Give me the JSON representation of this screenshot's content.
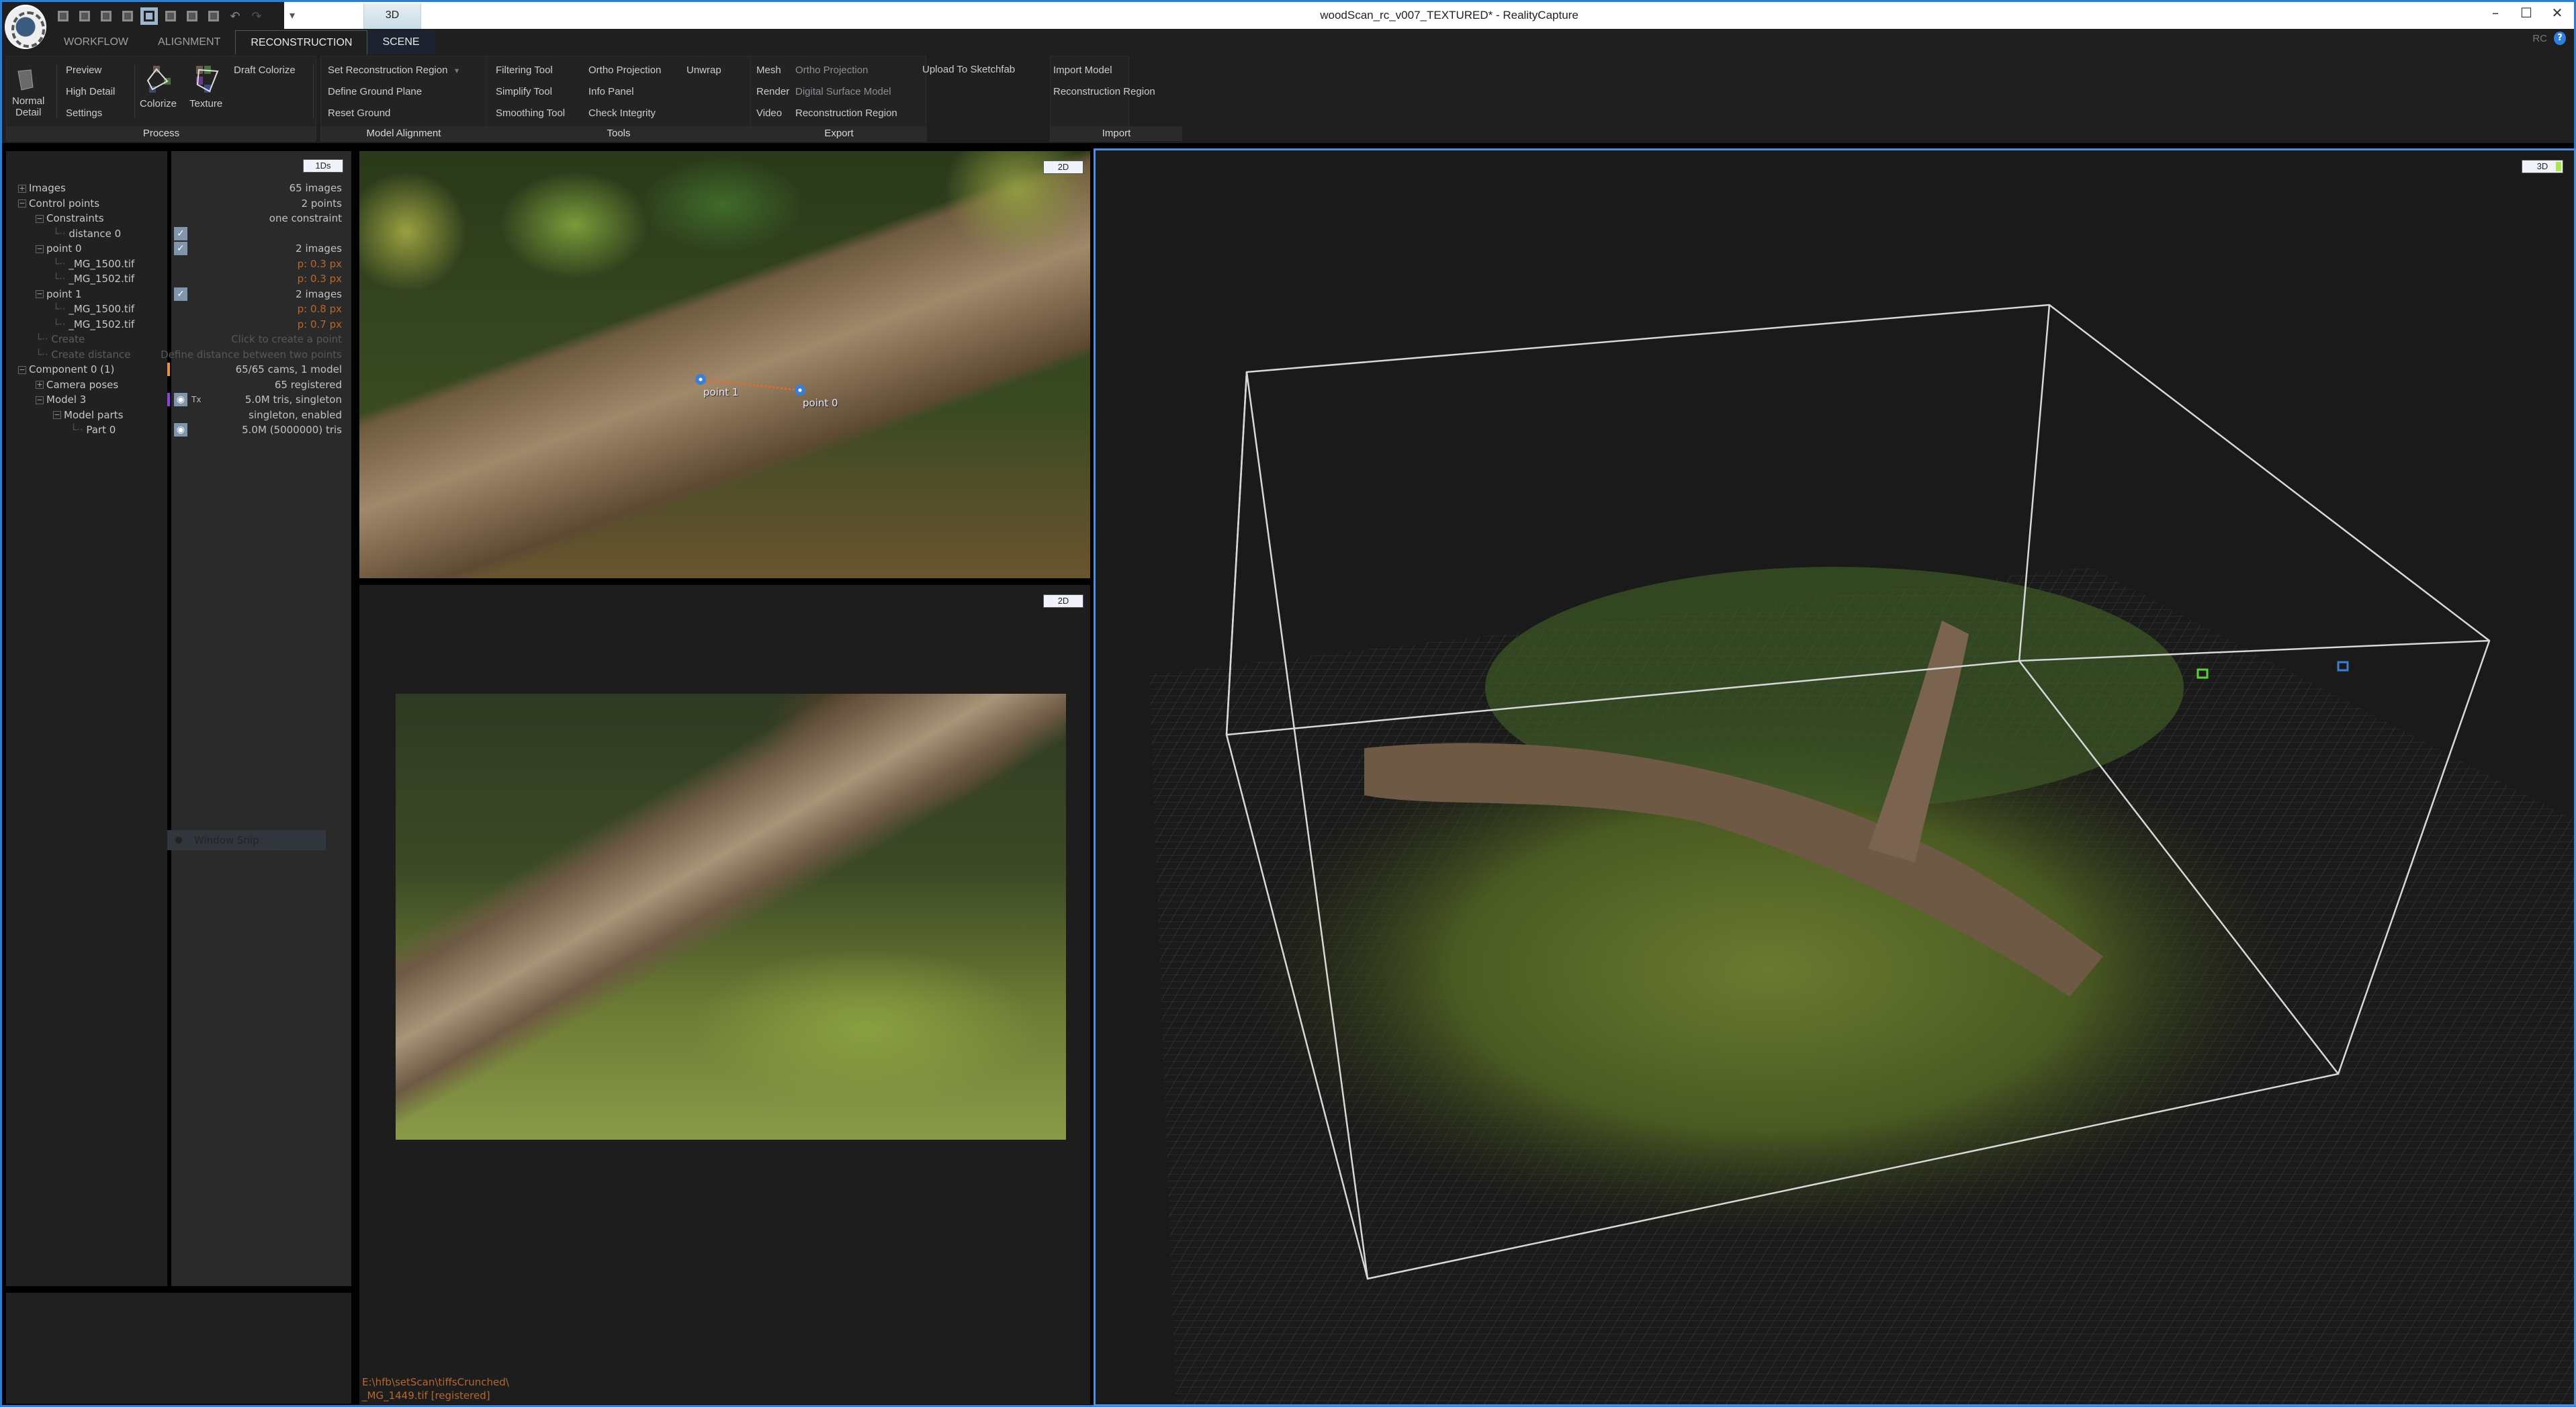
{
  "window": {
    "title": "woodScan_rc_v007_TEXTURED* - RealityCapture",
    "context_tab": "3D",
    "controls": {
      "minimize": "–",
      "maximize": "☐",
      "close": "✕"
    },
    "rc_badge": "RC",
    "help": "?"
  },
  "quick_access": {
    "icons": [
      "layout-1-icon",
      "layout-3col-icon",
      "layout-2col-icon",
      "layout-split-icon",
      "layout-1plus2-icon",
      "layout-4-icon",
      "layout-top2-icon",
      "layout-grid-icon",
      "undo-icon",
      "redo-icon"
    ],
    "active_index": 4,
    "dropdown": "▾"
  },
  "ribbon": {
    "tabs": [
      {
        "label": "WORKFLOW",
        "state": "normal"
      },
      {
        "label": "ALIGNMENT",
        "state": "normal"
      },
      {
        "label": "RECONSTRUCTION",
        "state": "active"
      },
      {
        "label": "SCENE",
        "state": "context"
      }
    ],
    "groups": {
      "process": {
        "label": "Process",
        "normal_detail": "Normal\nDetail",
        "normal_detail_l1": "Normal",
        "normal_detail_l2": "Detail",
        "preview": "Preview",
        "high_detail": "High Detail",
        "settings": "Settings",
        "colorize": "Colorize",
        "texture": "Texture",
        "draft_colorize": "Draft Colorize"
      },
      "model_alignment": {
        "label": "Model Alignment",
        "set_region": "Set Reconstruction Region",
        "define_ground": "Define Ground Plane",
        "reset_ground": "Reset Ground"
      },
      "tools": {
        "label": "Tools",
        "filtering": "Filtering Tool",
        "simplify": "Simplify Tool",
        "smoothing": "Smoothing Tool",
        "ortho": "Ortho Projection",
        "info": "Info Panel",
        "integrity": "Check Integrity",
        "unwrap": "Unwrap"
      },
      "export": {
        "label": "Export",
        "mesh": "Mesh",
        "render": "Render",
        "video": "Video",
        "ortho": "Ortho Projection",
        "dsm": "Digital Surface Model",
        "region": "Reconstruction Region",
        "sketchfab": "Upload To Sketchfab"
      },
      "import": {
        "label": "Import",
        "model": "Import Model",
        "region": "Reconstruction Region"
      }
    }
  },
  "tree": {
    "mode_button": "1Ds",
    "rows": [
      {
        "label": "Images",
        "expander": "+",
        "value": "65 images",
        "value_style": "normal"
      },
      {
        "label": "Control points",
        "expander": "−",
        "value": "2 points",
        "value_style": "normal"
      },
      {
        "label": "Constraints",
        "expander": "−",
        "value": "one constraint",
        "value_style": "normal"
      },
      {
        "label": "distance 0",
        "expander": "",
        "value": "",
        "value_style": "normal",
        "checked": true
      },
      {
        "label": "point 0",
        "expander": "−",
        "value": "2 images",
        "value_style": "normal",
        "checked": true
      },
      {
        "label": "_MG_1500.tif",
        "expander": "",
        "value": "p: 0.3 px",
        "value_style": "orange"
      },
      {
        "label": "_MG_1502.tif",
        "expander": "",
        "value": "p: 0.3 px",
        "value_style": "orange"
      },
      {
        "label": "point 1",
        "expander": "−",
        "value": "2 images",
        "value_style": "normal",
        "checked": true
      },
      {
        "label": "_MG_1500.tif",
        "expander": "",
        "value": "p: 0.8 px",
        "value_style": "orange"
      },
      {
        "label": "_MG_1502.tif",
        "expander": "",
        "value": "p: 0.7 px",
        "value_style": "orange"
      },
      {
        "label": "Create",
        "expander": "",
        "value": "Click to create a point",
        "value_style": "dim"
      },
      {
        "label": "Create distance",
        "expander": "",
        "value": "Define distance between two points",
        "value_style": "dim"
      },
      {
        "label": "Component 0 (1)",
        "expander": "−",
        "value": "65/65 cams, 1 model",
        "value_style": "normal",
        "marker": "#e8903a"
      },
      {
        "label": "Camera poses",
        "expander": "+",
        "value": "65 registered",
        "value_style": "normal"
      },
      {
        "label": "Model 3",
        "expander": "−",
        "value": "5.0M tris, singleton",
        "value_style": "normal",
        "marker": "#9040e0",
        "eye": true,
        "tx": "Tx"
      },
      {
        "label": "Model parts",
        "expander": "−",
        "value": "singleton, enabled",
        "value_style": "normal"
      },
      {
        "label": "Part 0",
        "expander": "",
        "value": "5.0M (5000000) tris",
        "value_style": "normal",
        "eye": true
      }
    ]
  },
  "snip_tooltip": "Window Snip",
  "viewports": {
    "top_image": {
      "mode": "2D",
      "control_points": [
        {
          "label": "point 1"
        },
        {
          "label": "point 0"
        }
      ]
    },
    "bottom_image": {
      "mode": "2D",
      "path_line1": "E:\\hfb\\setScan\\tiffsCrunched\\",
      "path_line2": "_MG_1449.tif [registered]"
    },
    "scene_3d": {
      "mode": "3D",
      "accent": "#a8e84a"
    }
  },
  "colors": {
    "accent_blue": "#4a90e2",
    "orange_value": "#b8672c",
    "panel_bg": "#212121"
  }
}
